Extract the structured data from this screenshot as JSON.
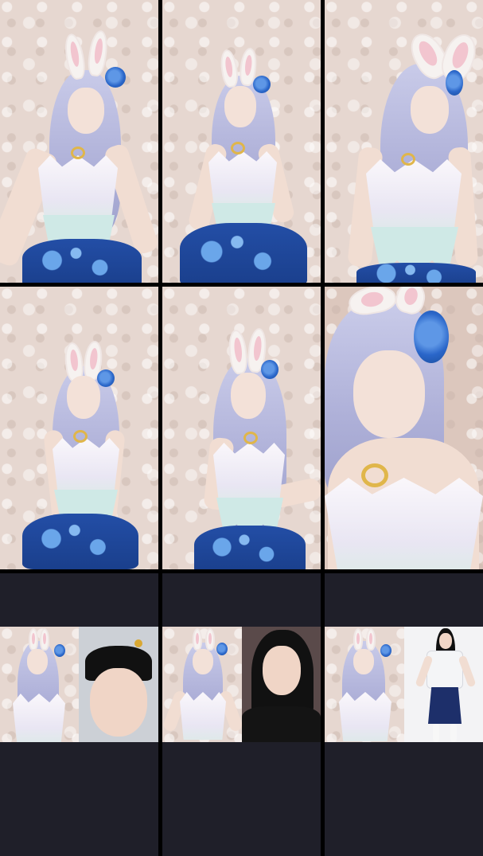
{
  "grid": {
    "cells": [
      {
        "name": "video-cell-1"
      },
      {
        "name": "video-cell-2"
      },
      {
        "name": "video-cell-3"
      },
      {
        "name": "video-cell-4"
      },
      {
        "name": "video-cell-5"
      },
      {
        "name": "video-cell-6"
      },
      {
        "name": "duet-cell-1"
      },
      {
        "name": "duet-cell-2"
      },
      {
        "name": "duet-cell-3"
      }
    ]
  },
  "colors": {
    "background": "#000000",
    "empty_panel": "#1f1f29",
    "wig": "#b5b8de",
    "skirt": "#1f47a0",
    "rose": "#2a66c9"
  }
}
